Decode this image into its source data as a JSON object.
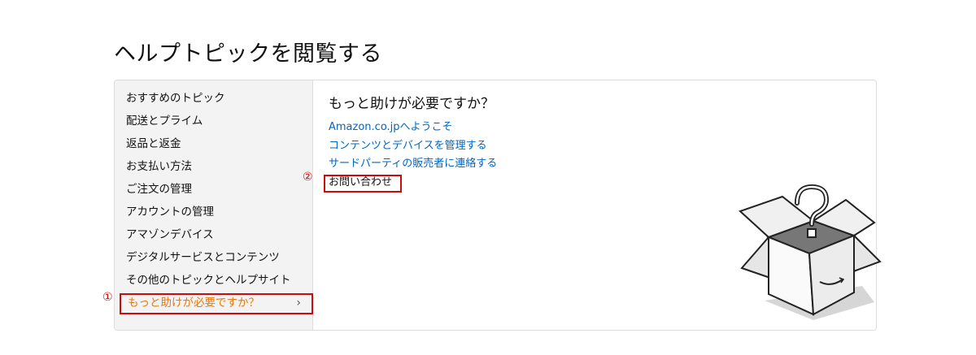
{
  "page_title": "ヘルプトピックを閲覧する",
  "sidebar": {
    "items": [
      {
        "label": "おすすめのトピック"
      },
      {
        "label": "配送とプライム"
      },
      {
        "label": "返品と返金"
      },
      {
        "label": "お支払い方法"
      },
      {
        "label": "ご注文の管理"
      },
      {
        "label": "アカウントの管理"
      },
      {
        "label": "アマゾンデバイス"
      },
      {
        "label": "デジタルサービスとコンテンツ"
      },
      {
        "label": "その他のトピックとヘルプサイト"
      },
      {
        "label": "もっと助けが必要ですか？",
        "selected": true
      }
    ],
    "chevron": "›"
  },
  "main": {
    "heading": "もっと助けが必要ですか？",
    "links": [
      {
        "label": "Amazon.co.jpへようこそ"
      },
      {
        "label": "コンテンツとデバイスを管理する"
      },
      {
        "label": "サードパーティの販売者に連絡する"
      },
      {
        "label": "お問い合わせ",
        "highlighted": true
      }
    ]
  },
  "annotations": {
    "marker_1": "①",
    "marker_2": "②",
    "color": "#cc0c0c"
  },
  "illustration": {
    "icon": "question-box-icon",
    "symbol": "?"
  },
  "colors": {
    "link": "#0066c0",
    "active": "#e47911",
    "sidebar_bg": "#f3f3f3"
  }
}
